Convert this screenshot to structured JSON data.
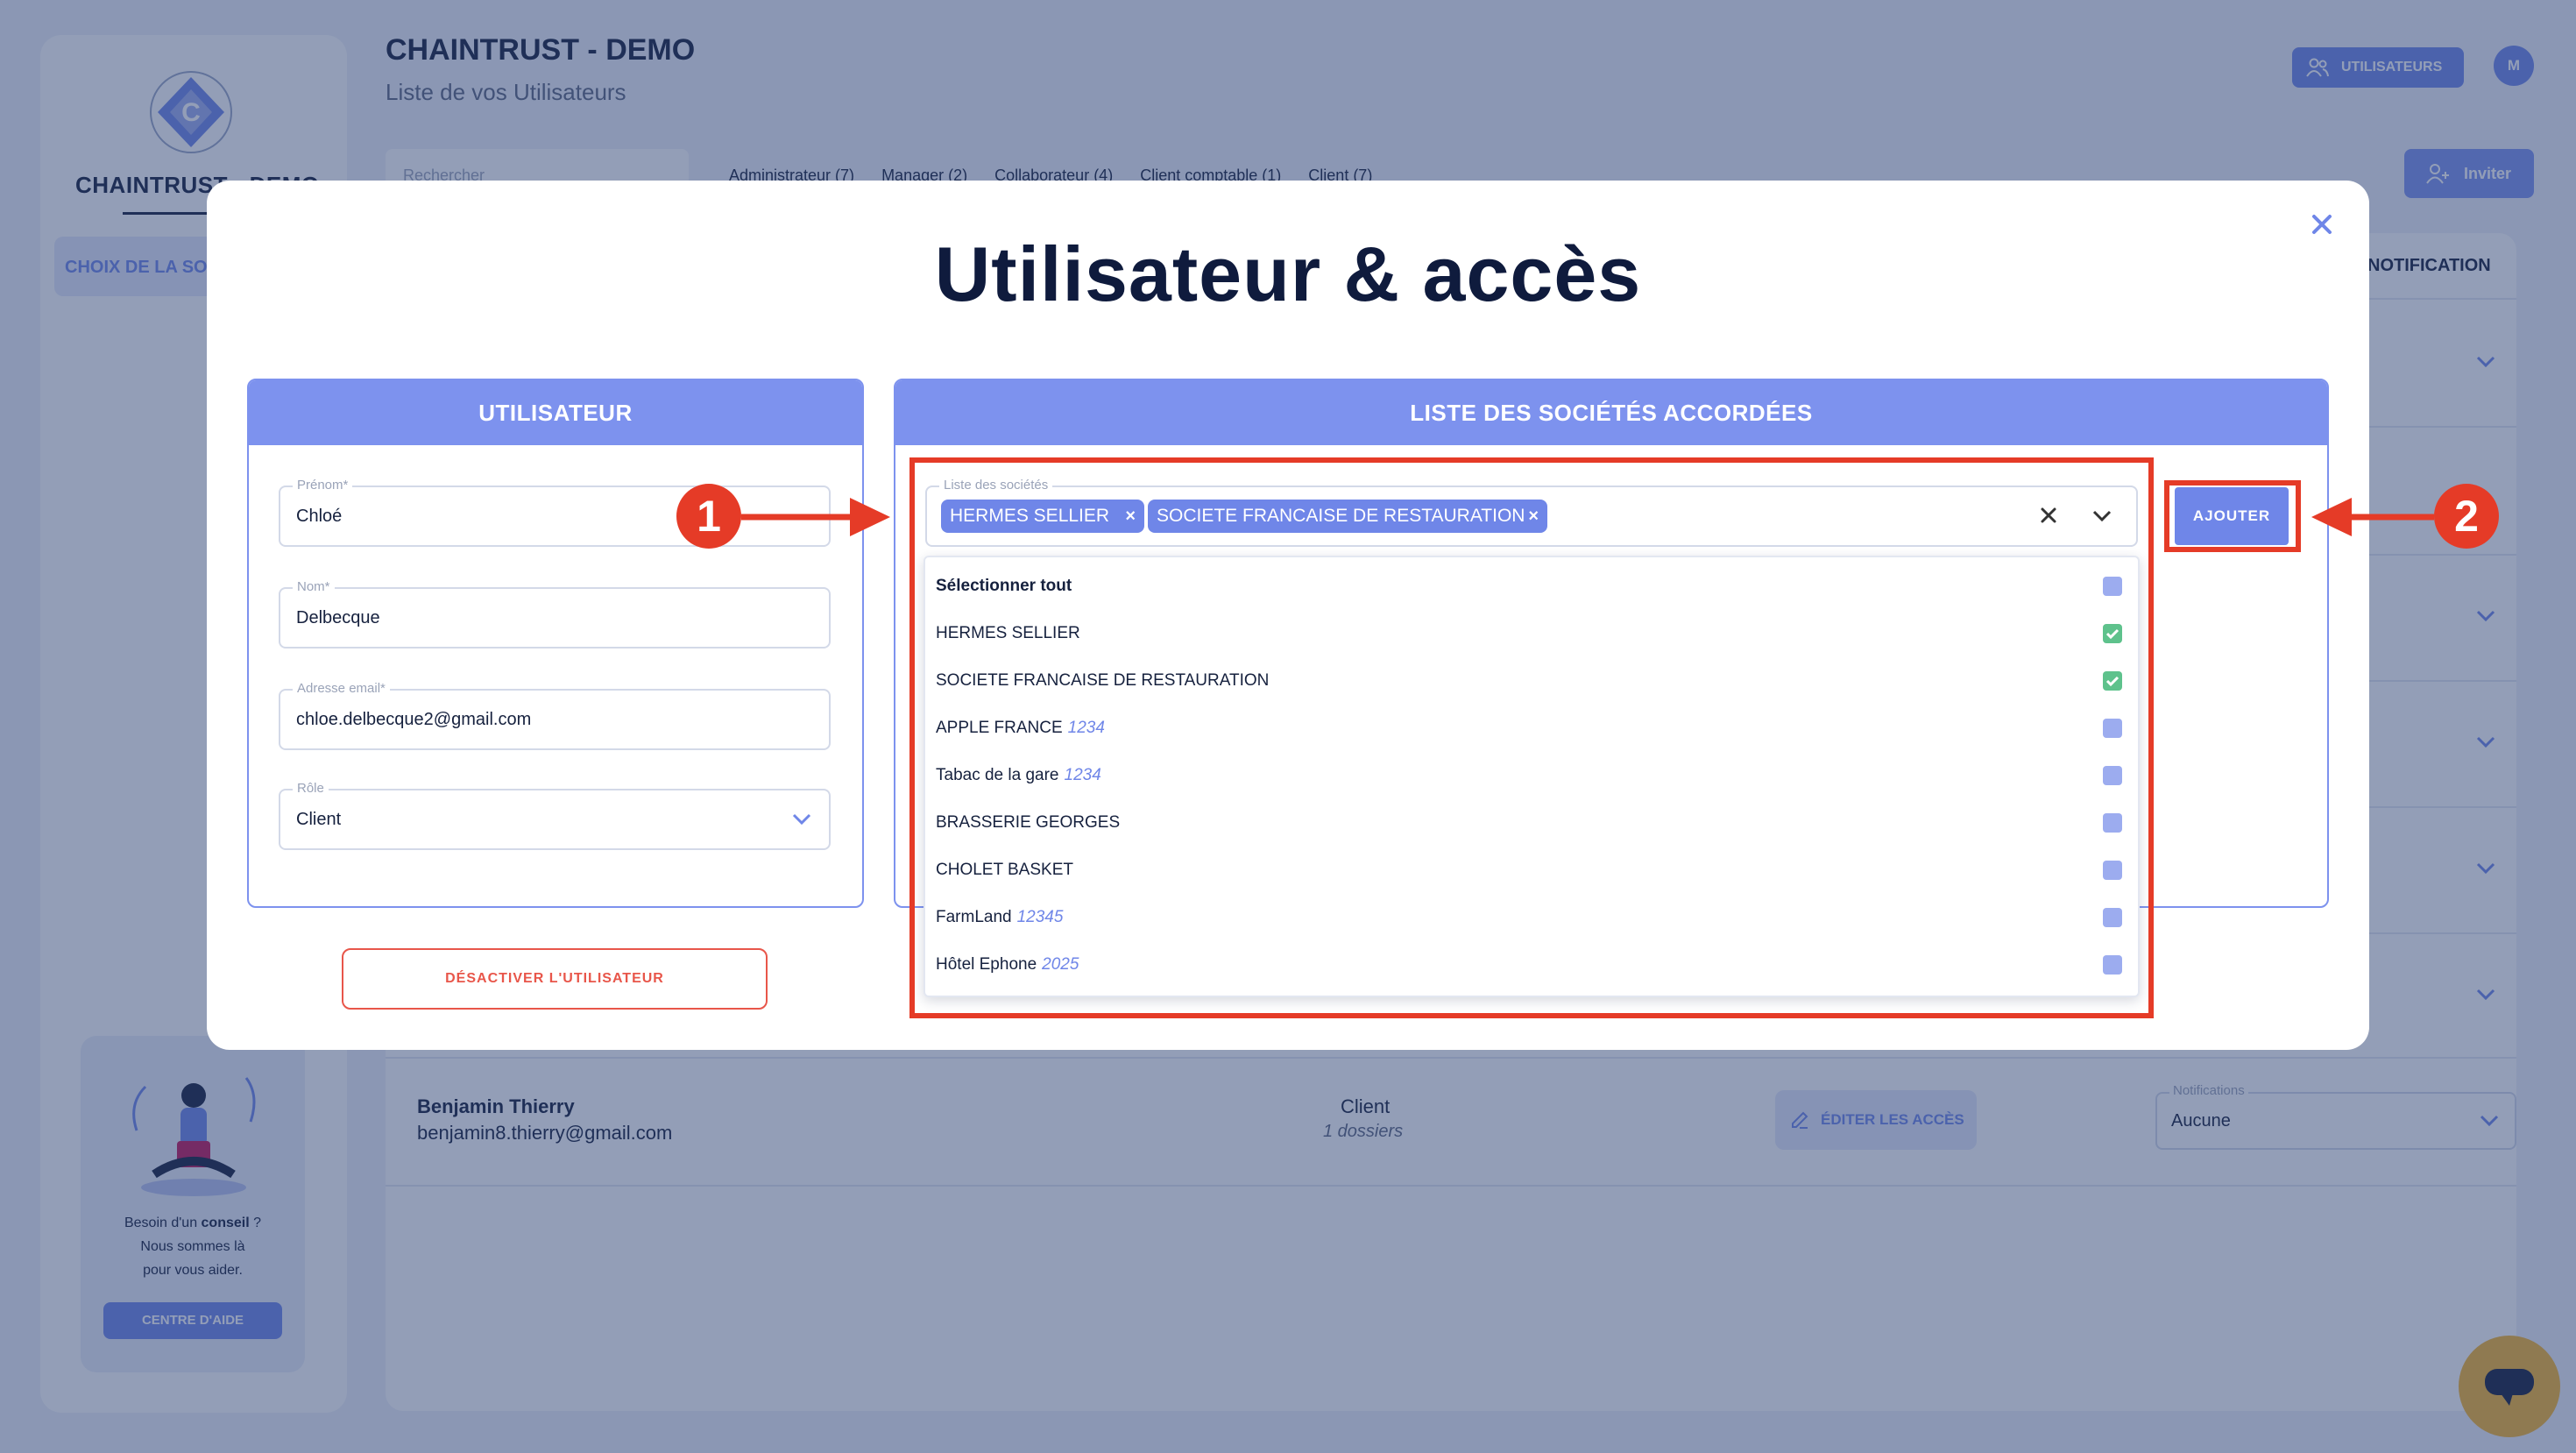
{
  "app": {
    "logo_text": "CHAINTRUST - DEMO",
    "company_select": "CHOIX DE LA SOCIÉTÉ",
    "title": "CHAINTRUST - DEMO",
    "subtitle": "Liste de vos Utilisateurs",
    "users_button": "UTILISATEURS",
    "avatar_initial": "M",
    "invite_button": "Inviter",
    "search_placeholder": "Rechercher",
    "filters": [
      "Administrateur (7)",
      "Manager (2)",
      "Collaborateur (4)",
      "Client comptable (1)",
      "Client (7)"
    ],
    "notifications_header": "NOTIFICATION",
    "help": {
      "line1_prefix": "Besoin d'un ",
      "line1_bold": "conseil",
      "line1_suffix": " ?",
      "line2": "Nous sommes là",
      "line3": "pour vous aider.",
      "button": "CENTRE D'AIDE"
    },
    "visible_row": {
      "name": "Benjamin Thierry",
      "email": "benjamin8.thierry@gmail.com",
      "role": "Client",
      "folders": "1 dossiers",
      "edit_button": "ÉDITER LES ACCÈS",
      "notif_label": "Notifications",
      "notif_value": "Aucune"
    }
  },
  "modal": {
    "title": "Utilisateur & accès",
    "user_panel": {
      "header": "UTILISATEUR",
      "first_name_label": "Prénom*",
      "first_name": "Chloé",
      "last_name_label": "Nom*",
      "last_name": "Delbecque",
      "email_label": "Adresse email*",
      "email": "chloe.delbecque2@gmail.com",
      "role_label": "Rôle",
      "role": "Client"
    },
    "deactivate_button": "DÉSACTIVER L'UTILISATEUR",
    "companies_panel": {
      "header": "LISTE DES SOCIÉTÉS ACCORDÉES",
      "select_label": "Liste des sociétés",
      "selected_chips": [
        "HERMES SELLIER",
        "SOCIETE FRANCAISE DE RESTAURATION"
      ],
      "add_button": "AJOUTER",
      "options": [
        {
          "name": "Sélectionner tout",
          "code": "",
          "checked": false
        },
        {
          "name": "HERMES SELLIER",
          "code": "",
          "checked": true
        },
        {
          "name": "SOCIETE FRANCAISE DE RESTAURATION",
          "code": "",
          "checked": true
        },
        {
          "name": "APPLE FRANCE",
          "code": "1234",
          "checked": false
        },
        {
          "name": "Tabac de la gare",
          "code": "1234",
          "checked": false
        },
        {
          "name": "BRASSERIE GEORGES",
          "code": "",
          "checked": false
        },
        {
          "name": "CHOLET BASKET",
          "code": "",
          "checked": false
        },
        {
          "name": "FarmLand",
          "code": "12345",
          "checked": false
        },
        {
          "name": "Hôtel Ephone",
          "code": "2025",
          "checked": false
        }
      ]
    }
  },
  "annotations": {
    "badge_1": "1",
    "badge_2": "2",
    "color": "#e53b27"
  },
  "colors": {
    "accent": "#6f86e8",
    "panel_header": "#7d92ee",
    "danger": "#e8564a",
    "check": "#5ec28c",
    "chat": "#f7b733"
  }
}
